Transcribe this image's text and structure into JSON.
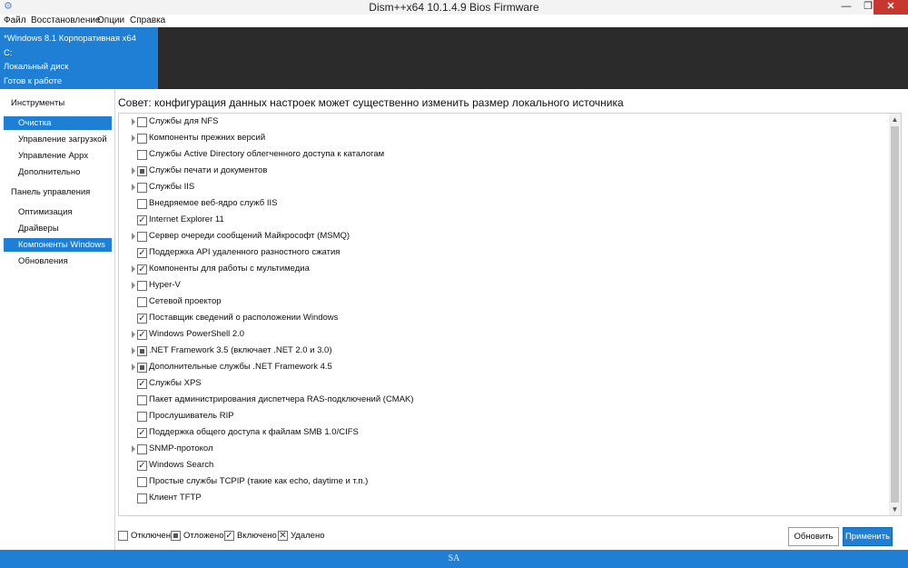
{
  "window": {
    "title": "Dism++x64 10.1.4.9 Bios Firmware",
    "min_glyph": "—",
    "max_glyph": "❐",
    "close_glyph": "✕"
  },
  "menu": [
    "Файл",
    "Восстановление",
    "Опции",
    "Справка"
  ],
  "header": {
    "lines": [
      "*Windows 8.1 Корпоративная x64",
      "C:",
      "Локальный диск",
      "Готов к работе"
    ]
  },
  "sidebar": {
    "section1": "Инструменты",
    "tools": [
      "Очистка",
      "Управление загрузкой",
      "Управление Appx",
      "Дополнительно"
    ],
    "section2": "Панель управления",
    "control": [
      "Оптимизация",
      "Драйверы",
      "Компоненты Windows",
      "Обновления"
    ],
    "active": "Очистка"
  },
  "main": {
    "tip": "Совет: конфигурация данных настроек может существенно изменить размер локального источника",
    "features": [
      {
        "label": "Службы для NFS",
        "state": "off",
        "expandable": true
      },
      {
        "label": "Компоненты прежних версий",
        "state": "off",
        "expandable": true
      },
      {
        "label": "Службы Active Directory облегченного доступа к каталогам",
        "state": "off",
        "expandable": false
      },
      {
        "label": "Службы печати и документов",
        "state": "partial",
        "expandable": true
      },
      {
        "label": "Службы IIS",
        "state": "off",
        "expandable": true
      },
      {
        "label": "Внедряемое веб-ядро служб IIS",
        "state": "off",
        "expandable": false
      },
      {
        "label": "Internet Explorer 11",
        "state": "on",
        "expandable": false
      },
      {
        "label": "Сервер очереди сообщений Майкрософт (MSMQ)",
        "state": "off",
        "expandable": true
      },
      {
        "label": "Поддержка API удаленного разностного сжатия",
        "state": "on",
        "expandable": false
      },
      {
        "label": "Компоненты для работы с мультимедиа",
        "state": "on",
        "expandable": true
      },
      {
        "label": "Hyper-V",
        "state": "off",
        "expandable": true
      },
      {
        "label": "Сетевой проектор",
        "state": "off",
        "expandable": false
      },
      {
        "label": "Поставщик сведений о расположении Windows",
        "state": "on",
        "expandable": false
      },
      {
        "label": "Windows PowerShell 2.0",
        "state": "on",
        "expandable": true
      },
      {
        "label": ".NET Framework 3.5 (включает .NET 2.0 и 3.0)",
        "state": "partial",
        "expandable": true
      },
      {
        "label": "Дополнительные службы .NET Framework 4.5",
        "state": "partial",
        "expandable": true
      },
      {
        "label": "Службы XPS",
        "state": "on",
        "expandable": false
      },
      {
        "label": "Пакет администрирования диспетчера RAS-подключений (CMAK)",
        "state": "off",
        "expandable": false
      },
      {
        "label": "Прослушиватель RIP",
        "state": "off",
        "expandable": false
      },
      {
        "label": "Поддержка общего доступа к файлам SMB 1.0/CIFS",
        "state": "on",
        "expandable": false
      },
      {
        "label": "SNMP-протокол",
        "state": "off",
        "expandable": true
      },
      {
        "label": "Windows Search",
        "state": "on",
        "expandable": false
      },
      {
        "label": "Простые службы TCPIP (такие как echo, daytime и т.п.)",
        "state": "off",
        "expandable": false
      },
      {
        "label": "Клиент TFTP",
        "state": "off",
        "expandable": false
      }
    ],
    "check_glyph": "✓",
    "removed_glyph": "✕"
  },
  "legend": {
    "off": "Отключен",
    "pending": "Отложено",
    "on": "Включено",
    "removed": "Удалено"
  },
  "buttons": {
    "refresh": "Обновить",
    "apply": "Применить"
  },
  "statusbar": {
    "text": "SA"
  },
  "colors": {
    "accent": "#1e7fd4",
    "header_dark": "#2b2b2b",
    "close_red": "#c7372f"
  }
}
